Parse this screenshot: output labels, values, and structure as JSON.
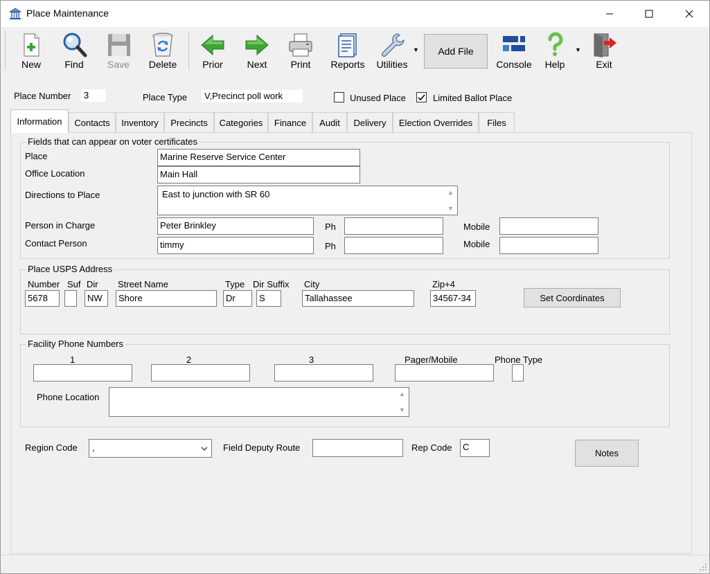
{
  "window": {
    "title": "Place Maintenance",
    "minimize_glyph": "─",
    "maximize_glyph": "☐",
    "close_glyph": "✕"
  },
  "toolbar": {
    "new": "New",
    "find": "Find",
    "save": "Save",
    "delete": "Delete",
    "prior": "Prior",
    "next": "Next",
    "print": "Print",
    "reports": "Reports",
    "utilities": "Utilities",
    "add_file": "Add File",
    "console": "Console",
    "help": "Help",
    "exit": "Exit"
  },
  "header": {
    "place_number_label": "Place Number",
    "place_number_value": "3",
    "place_type_label": "Place Type",
    "place_type_value": "V,Precinct poll work",
    "unused_place_label": "Unused Place",
    "unused_place_checked": false,
    "limited_ballot_label": "Limited Ballot Place",
    "limited_ballot_checked": true
  },
  "tabs": [
    {
      "label": "Information",
      "active": true
    },
    {
      "label": "Contacts"
    },
    {
      "label": "Inventory"
    },
    {
      "label": "Precincts"
    },
    {
      "label": "Categories"
    },
    {
      "label": "Finance"
    },
    {
      "label": "Audit"
    },
    {
      "label": "Delivery"
    },
    {
      "label": "Election Overrides"
    },
    {
      "label": "Files"
    }
  ],
  "certificates": {
    "group_title": "Fields that can appear on voter certificates",
    "place_label": "Place",
    "place_value": "Marine Reserve Service Center",
    "office_location_label": "Office Location",
    "office_location_value": "Main Hall",
    "directions_label": "Directions to Place",
    "directions_value": "East to junction with SR 60",
    "person_in_charge_label": "Person in Charge",
    "person_in_charge_value": "Peter Brinkley",
    "contact_person_label": "Contact Person",
    "contact_person_value": "timmy",
    "ph_label": "Ph",
    "mobile_label": "Mobile",
    "pic_ph_value": "",
    "pic_mobile_value": "",
    "cp_ph_value": "",
    "cp_mobile_value": ""
  },
  "address": {
    "group_title": "Place USPS Address",
    "number_label": "Number",
    "suf_label": "Suf",
    "dir_label": "Dir",
    "street_label": "Street Name",
    "type_label": "Type",
    "dir_suffix_label": "Dir Suffix",
    "city_label": "City",
    "zip_label": "Zip+4",
    "number_value": "5678",
    "suf_value": "",
    "dir_value": "NW",
    "street_value": "Shore",
    "type_value": "Dr",
    "dir_suffix_value": "S",
    "city_value": "Tallahassee",
    "zip_value": "34567-34",
    "set_coordinates_label": "Set Coordinates"
  },
  "facility": {
    "group_title": "Facility Phone Numbers",
    "col1_label": "1",
    "col2_label": "2",
    "col3_label": "3",
    "pager_label": "Pager/Mobile",
    "phone_type_label": "Phone Type",
    "phone_location_label": "Phone Location"
  },
  "footer": {
    "region_code_label": "Region Code",
    "region_code_value": ",",
    "field_deputy_label": "Field Deputy Route",
    "field_deputy_value": "",
    "rep_code_label": "Rep Code",
    "rep_code_value": "C",
    "notes_label": "Notes"
  },
  "colors": {
    "accent_green": "#3fa535",
    "delete_blue": "#2d7bd6",
    "exit_red": "#e02020",
    "help_green": "#6cc04a"
  }
}
